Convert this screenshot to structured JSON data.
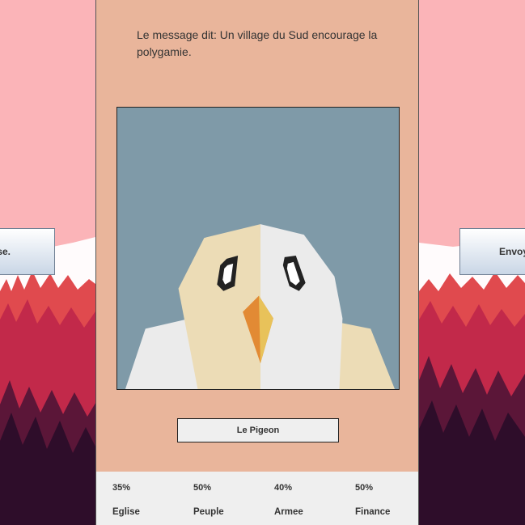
{
  "left_button": {
    "label": "se."
  },
  "right_button": {
    "label": "Envoy"
  },
  "card": {
    "message": "Le message dit: Un village du Sud encourage la polygamie.",
    "character_name": "Le Pigeon"
  },
  "stats": [
    {
      "value": "35%",
      "label": "Eglise"
    },
    {
      "value": "50%",
      "label": "Peuple"
    },
    {
      "value": "40%",
      "label": "Armee"
    },
    {
      "value": "50%",
      "label": "Finance"
    }
  ],
  "colors": {
    "sky": "#fbb4b8",
    "card": "#e9b59b",
    "portrait_bg": "#7f9aa8",
    "forest_red": "#c2294a",
    "forest_dark": "#2e0d2a"
  }
}
